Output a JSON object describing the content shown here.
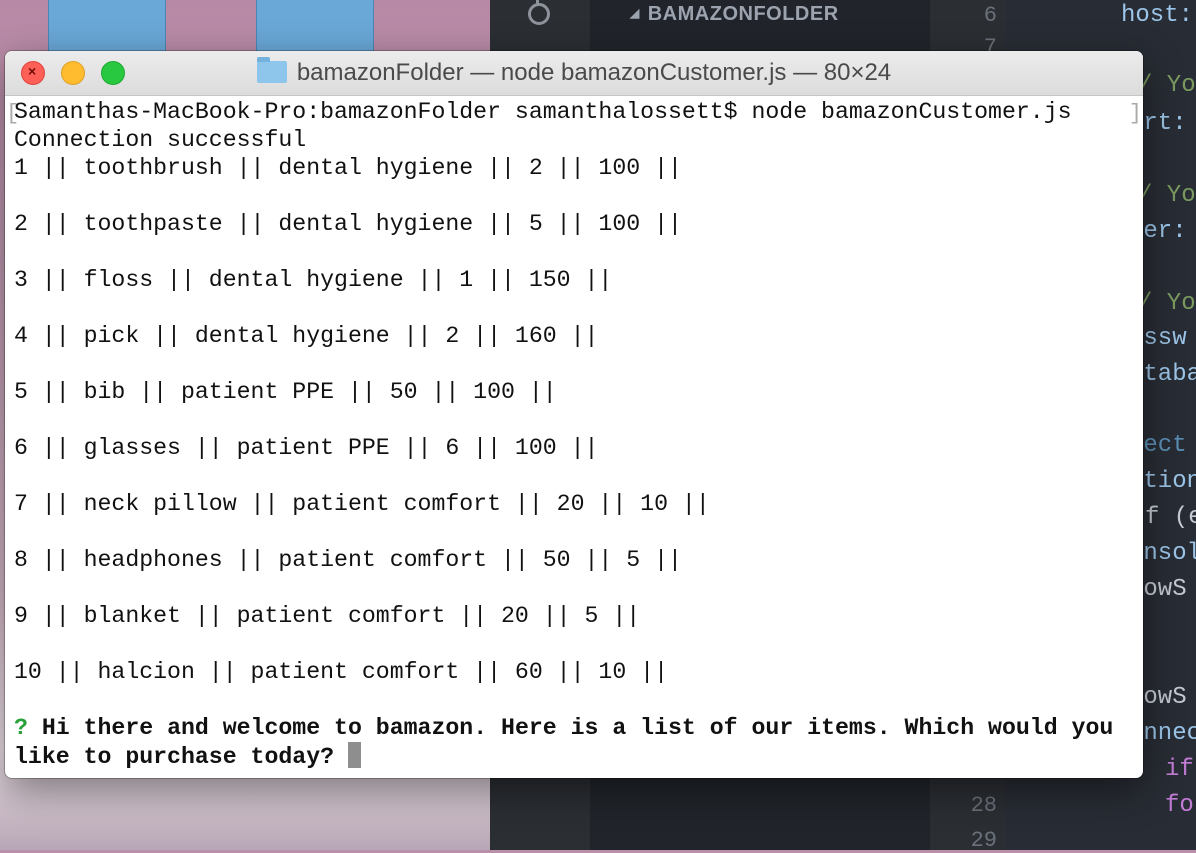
{
  "explorer": {
    "title": "BAMAZONFOLDER"
  },
  "editor": {
    "line_numbers": [
      "6",
      "7",
      "28",
      "29"
    ],
    "code_fragments": [
      "host:",
      "/ You",
      "ort:",
      "/ You",
      "ser:",
      "/ You",
      "assw",
      "ataba",
      "nect",
      "ction",
      "f (e",
      "onsol",
      "howS",
      "howS",
      "onnec",
      "if",
      "fo"
    ]
  },
  "terminal": {
    "title": "bamazonFolder — node bamazonCustomer.js — 80×24",
    "command_line": "Samanthas-MacBook-Pro:bamazonFolder samanthalossett$ node bamazonCustomer.js",
    "status": "Connection successful",
    "items": [
      "1 || toothbrush || dental hygiene || 2 || 100 ||",
      "2 || toothpaste || dental hygiene || 5 || 100 ||",
      "3 || floss || dental hygiene || 1 || 150 ||",
      "4 || pick || dental hygiene || 2 || 160 ||",
      "5 || bib || patient PPE || 50 || 100 ||",
      "6 || glasses || patient PPE || 6 || 100 ||",
      "7 || neck pillow || patient comfort || 20 || 10 ||",
      "8 || headphones || patient comfort || 50 || 5 ||",
      "9 || blanket || patient comfort || 20 || 5 ||",
      "10 || halcion || patient comfort || 60 || 10 ||"
    ],
    "prompt_symbol": "?",
    "prompt_line1": "Hi there and welcome to bamazon. Here is a list of our items. Which would you",
    "prompt_line2": "like to purchase today?"
  },
  "colors": {
    "close": "#fe5f57",
    "minimize": "#febc2e",
    "maximize": "#28c840",
    "prompt_symbol": "#2aa13b"
  }
}
